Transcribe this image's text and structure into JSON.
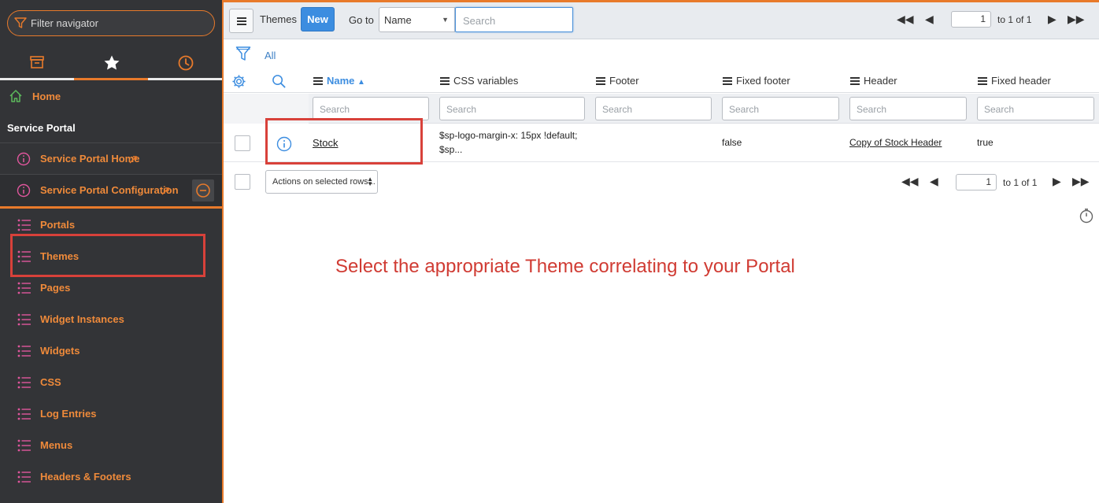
{
  "sidebar": {
    "filter_placeholder": "Filter navigator",
    "tabs": [
      {
        "name": "all-applications",
        "icon": "archive-icon"
      },
      {
        "name": "favorites",
        "icon": "star-icon",
        "active": true
      },
      {
        "name": "history",
        "icon": "clock-icon"
      }
    ],
    "home_label": "Home",
    "section_label": "Service Portal",
    "items": [
      {
        "label": "Service Portal Home"
      },
      {
        "label": "Service Portal Configuration"
      }
    ],
    "modules": [
      {
        "label": "Portals"
      },
      {
        "label": "Themes"
      },
      {
        "label": "Pages"
      },
      {
        "label": "Widget Instances"
      },
      {
        "label": "Widgets"
      },
      {
        "label": "CSS"
      },
      {
        "label": "Log Entries"
      },
      {
        "label": "Menus"
      },
      {
        "label": "Headers & Footers"
      }
    ]
  },
  "toolbar": {
    "title": "Themes",
    "new_label": "New",
    "goto_label": "Go to",
    "goto_field": "Name",
    "search_placeholder": "Search",
    "page": "1",
    "page_of": "to 1 of 1"
  },
  "breadcrumb": {
    "all_label": "All"
  },
  "columns": [
    {
      "label": "Name",
      "sorted": "ascending"
    },
    {
      "label": "CSS variables"
    },
    {
      "label": "Footer"
    },
    {
      "label": "Fixed footer"
    },
    {
      "label": "Header"
    },
    {
      "label": "Fixed header"
    }
  ],
  "column_search_placeholder": "Search",
  "rows": [
    {
      "name": "Stock",
      "css_variables_line1": "$sp-logo-margin-x: 15px !default;",
      "css_variables_line2": "$sp...",
      "footer": "",
      "fixed_footer": "false",
      "header": "Copy of Stock Header",
      "fixed_header": "true"
    }
  ],
  "actions": {
    "select_label": "Actions on selected rows...",
    "page": "1",
    "page_of": "to 1 of 1"
  },
  "annotation": "Select the appropriate Theme correlating to your Portal",
  "colors": {
    "accent": "#e87a2b",
    "primary": "#3c8de0",
    "highlight": "#d8413a",
    "sidebar_bg": "#333437"
  }
}
